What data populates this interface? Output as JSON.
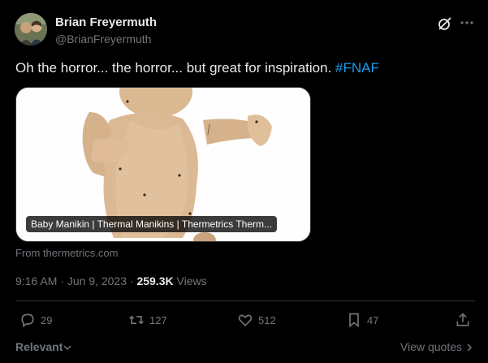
{
  "author": {
    "display_name": "Brian Freyermuth",
    "handle": "@BrianFreyermuth"
  },
  "tweet": {
    "text": "Oh the horror... the horror... but great for inspiration. ",
    "hashtag": "#FNAF"
  },
  "card": {
    "title": "Baby Manikin | Thermal Manikins | Thermetrics Therm...",
    "source": "From thermetrics.com"
  },
  "meta": {
    "time": "9:16 AM",
    "sep": " · ",
    "date": "Jun 9, 2023",
    "sep2": " · ",
    "views_count": "259.3K",
    "views_label": " Views"
  },
  "actions": {
    "replies": "29",
    "reposts": "127",
    "likes": "512",
    "bookmarks": "47"
  },
  "footer": {
    "sort_label": "Relevant",
    "view_quotes": "View quotes"
  },
  "colors": {
    "background": "#000000",
    "text": "#e7e9ea",
    "muted": "#71767b",
    "link": "#1d9bf0",
    "border": "#2f3336"
  }
}
